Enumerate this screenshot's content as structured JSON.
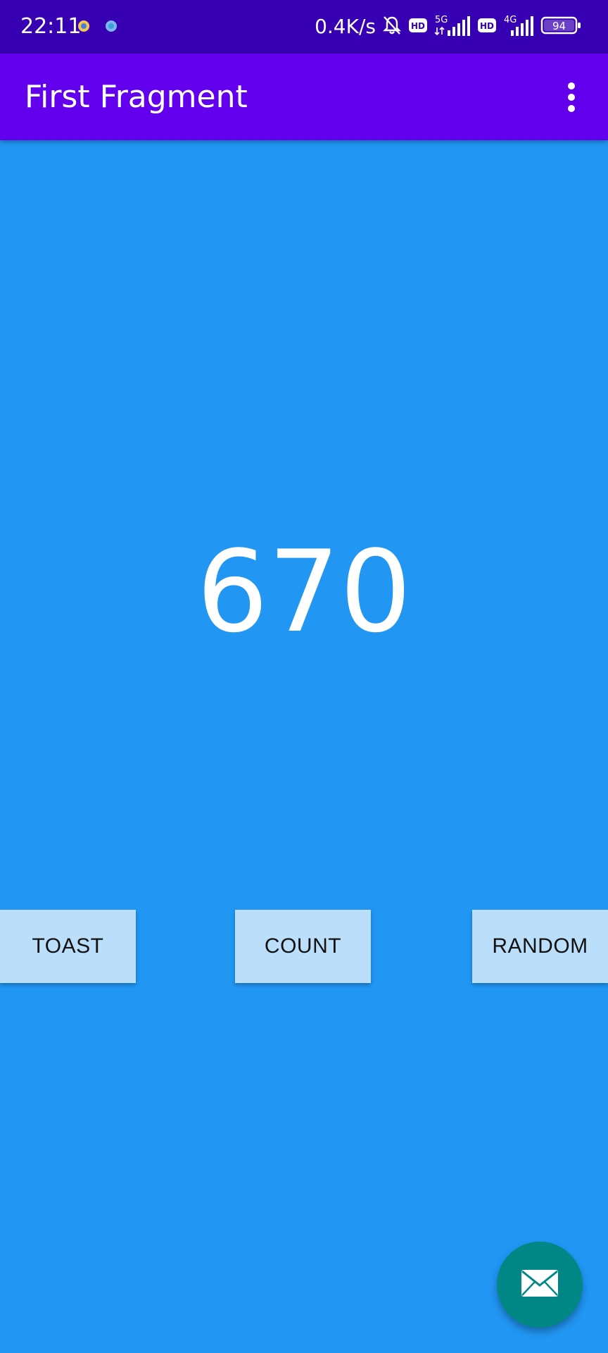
{
  "status_bar": {
    "time": "22:11",
    "net_speed": "0.4K/s",
    "network_1": "5G",
    "network_2": "4G",
    "hd_label": "HD",
    "battery": "94",
    "icons": [
      "app-notification-icon",
      "app-notification-icon",
      "mute-bell-icon",
      "hd-icon",
      "signal-5g-icon",
      "hd-icon",
      "signal-4g-icon",
      "battery-icon"
    ]
  },
  "app_bar": {
    "title": "First Fragment",
    "menu_icon": "overflow-menu-icon"
  },
  "main": {
    "count_value": "670"
  },
  "buttons": {
    "toast": "TOAST",
    "count": "COUNT",
    "random": "RANDOM"
  },
  "fab": {
    "icon": "email-icon"
  },
  "colors": {
    "status_bar": "#3700B3",
    "app_bar": "#6200EE",
    "background": "#2196F3",
    "button": "#BBDEFB",
    "fab": "#018786"
  }
}
